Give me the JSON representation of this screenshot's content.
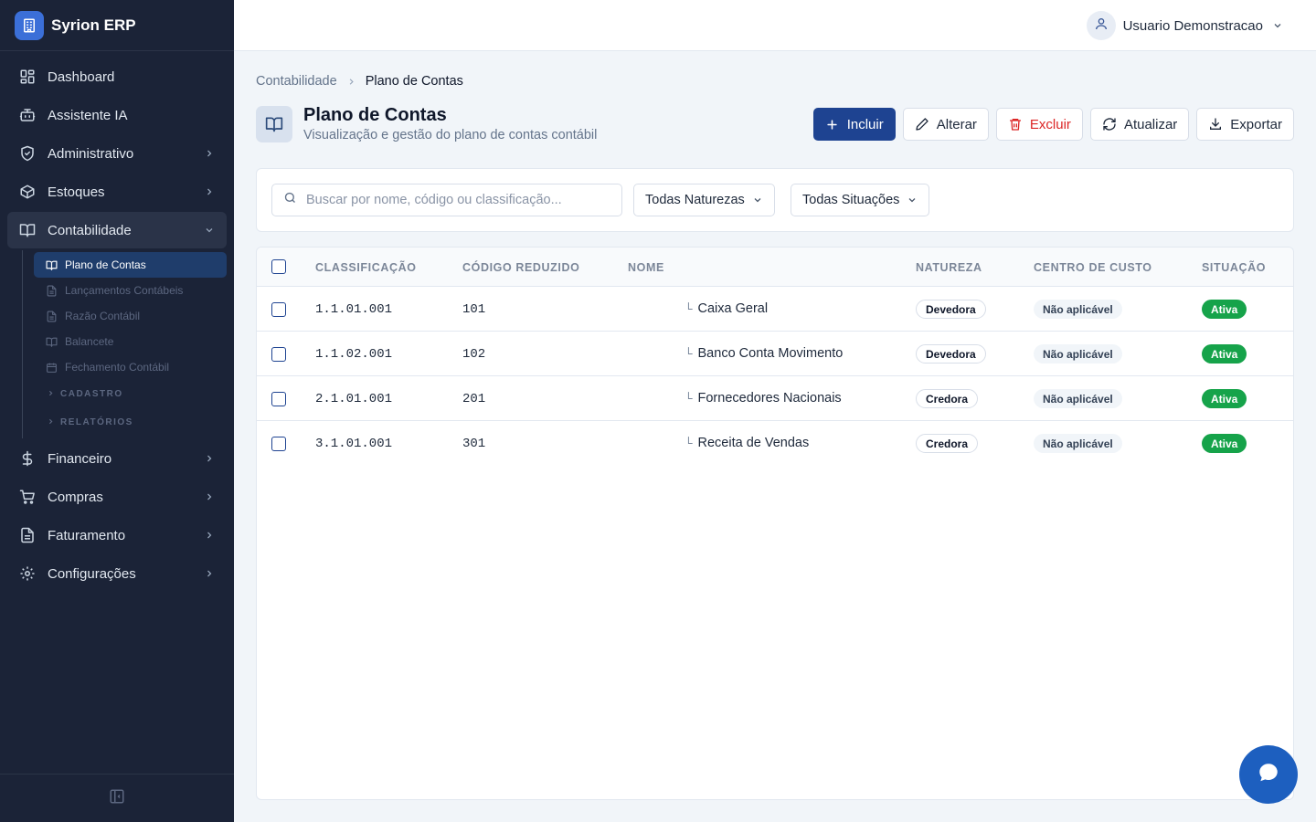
{
  "app": {
    "name": "Syrion ERP"
  },
  "sidebar": {
    "items": [
      {
        "label": "Dashboard",
        "icon": "dashboard-icon"
      },
      {
        "label": "Assistente IA",
        "icon": "bot-icon"
      },
      {
        "label": "Administrativo",
        "icon": "shield-icon"
      },
      {
        "label": "Estoques",
        "icon": "box-icon"
      },
      {
        "label": "Contabilidade",
        "icon": "book-icon"
      },
      {
        "label": "Financeiro",
        "icon": "dollar-icon"
      },
      {
        "label": "Compras",
        "icon": "cart-icon"
      },
      {
        "label": "Faturamento",
        "icon": "file-icon"
      },
      {
        "label": "Configurações",
        "icon": "gear-icon"
      }
    ],
    "sub_items": [
      {
        "label": "Plano de Contas",
        "icon": "book-icon"
      },
      {
        "label": "Lançamentos Contábeis",
        "icon": "file-icon"
      },
      {
        "label": "Razão Contábil",
        "icon": "file-icon"
      },
      {
        "label": "Balancete",
        "icon": "book-icon"
      },
      {
        "label": "Fechamento Contábil",
        "icon": "calendar-icon"
      }
    ],
    "sub_groups": [
      "CADASTRO",
      "RELATÓRIOS"
    ]
  },
  "header": {
    "user_name": "Usuario Demonstracao"
  },
  "breadcrumb": {
    "parent": "Contabilidade",
    "current": "Plano de Contas"
  },
  "page": {
    "title": "Plano de Contas",
    "subtitle": "Visualização e gestão do plano de contas contábil"
  },
  "actions": {
    "include": "Incluir",
    "edit": "Alterar",
    "delete": "Excluir",
    "refresh": "Atualizar",
    "export": "Exportar"
  },
  "filters": {
    "search_placeholder": "Buscar por nome, código ou classificação...",
    "nature": "Todas Naturezas",
    "status": "Todas Situações"
  },
  "table": {
    "headers": {
      "classification": "CLASSIFICAÇÃO",
      "code": "CÓDIGO REDUZIDO",
      "name": "NOME",
      "nature": "NATUREZA",
      "cost_center": "CENTRO DE CUSTO",
      "status": "SITUAÇÃO"
    },
    "rows": [
      {
        "classification": "1.1.01.001",
        "code": "101",
        "tree": "└",
        "name": "Caixa Geral",
        "nature": "Devedora",
        "cost_center": "Não aplicável",
        "status": "Ativa"
      },
      {
        "classification": "1.1.02.001",
        "code": "102",
        "tree": "└",
        "name": "Banco Conta Movimento",
        "nature": "Devedora",
        "cost_center": "Não aplicável",
        "status": "Ativa"
      },
      {
        "classification": "2.1.01.001",
        "code": "201",
        "tree": "└",
        "name": "Fornecedores Nacionais",
        "nature": "Credora",
        "cost_center": "Não aplicável",
        "status": "Ativa"
      },
      {
        "classification": "3.1.01.001",
        "code": "301",
        "tree": "└",
        "name": "Receita de Vendas",
        "nature": "Credora",
        "cost_center": "Não aplicável",
        "status": "Ativa"
      }
    ]
  },
  "colors": {
    "sidebar_bg": "#1b2337",
    "primary": "#1e4391",
    "danger": "#dc2626",
    "success": "#16a34a",
    "fab": "#1d5fbf"
  }
}
